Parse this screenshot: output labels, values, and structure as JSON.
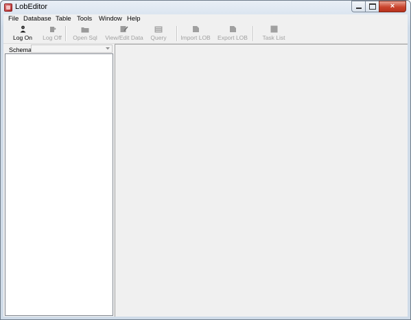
{
  "window": {
    "title": "LobEditor",
    "minimize_glyph": "minimize-icon",
    "maximize_glyph": "maximize-icon",
    "close_glyph": "×"
  },
  "menu": [
    "File",
    "Database",
    "Table",
    "Tools",
    "Window",
    "Help"
  ],
  "toolbar": {
    "log_on": "Log On",
    "log_off": "Log Off",
    "open_sql": "Open Sql",
    "view_edit_data": "View/Edit Data",
    "query": "Query",
    "import_lob": "Import LOB",
    "export_lob": "Export LOB",
    "task_list": "Task List"
  },
  "schema": {
    "label": "Schema",
    "value": ""
  },
  "colors": {
    "close_button": "#c9452e",
    "workspace": "#f0f0f0",
    "disabled_text": "#a0a0a0"
  }
}
